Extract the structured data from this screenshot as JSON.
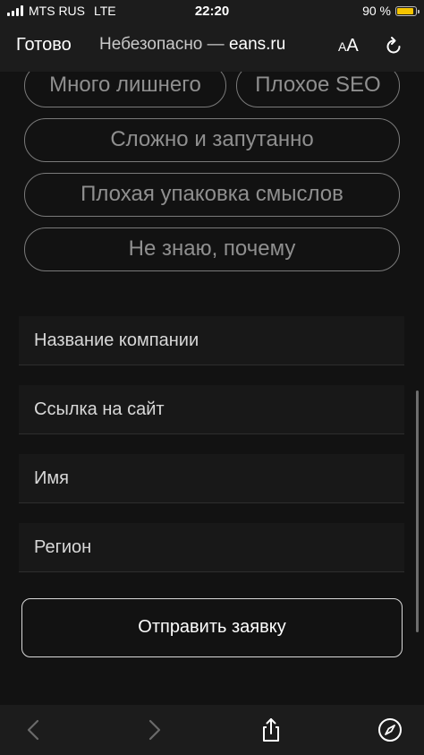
{
  "status_bar": {
    "carrier": "MTS RUS",
    "network": "LTE",
    "time": "22:20",
    "battery_percent": "90 %",
    "battery_level": 0.9,
    "battery_color": "#f5c400"
  },
  "toolbar": {
    "done_label": "Готово",
    "url_insecure": "Небезопасно — ",
    "url_domain": "eans.ru",
    "text_size_small": "A",
    "text_size_large": "A",
    "reload_icon": "reload-icon"
  },
  "chips": [
    {
      "label": "Много лишнего"
    },
    {
      "label": "Плохое SEO"
    },
    {
      "label": "Сложно и запутанно"
    },
    {
      "label": "Плохая упаковка смыслов"
    },
    {
      "label": "Не знаю, почему"
    }
  ],
  "form": {
    "fields": [
      {
        "placeholder": "Название компании"
      },
      {
        "placeholder": "Ссылка на сайт"
      },
      {
        "placeholder": "Имя"
      },
      {
        "placeholder": "Регион"
      }
    ],
    "submit_label": "Отправить заявку"
  },
  "bottom_bar": {
    "icons": [
      "back-icon",
      "forward-icon",
      "share-icon",
      "compass-icon"
    ]
  }
}
